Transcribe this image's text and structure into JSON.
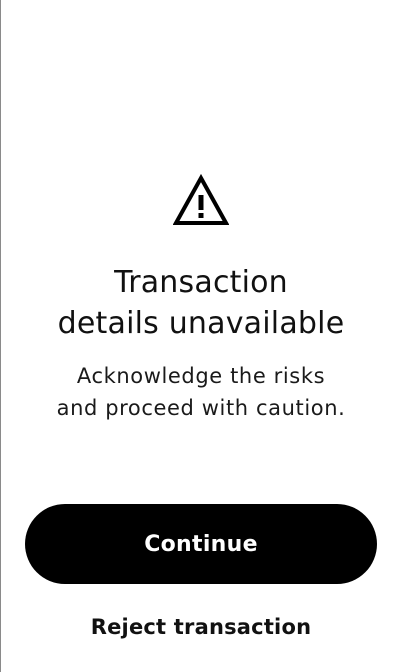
{
  "warning": {
    "icon": "warning-triangle-icon"
  },
  "title": {
    "line1": "Transaction",
    "line2": "details unavailable"
  },
  "subtitle": {
    "line1": "Acknowledge the risks",
    "line2": "and proceed with caution."
  },
  "actions": {
    "continue_label": "Continue",
    "reject_label": "Reject transaction"
  },
  "colors": {
    "background": "#ffffff",
    "text": "#111111",
    "button_bg": "#000000",
    "button_text": "#ffffff"
  }
}
